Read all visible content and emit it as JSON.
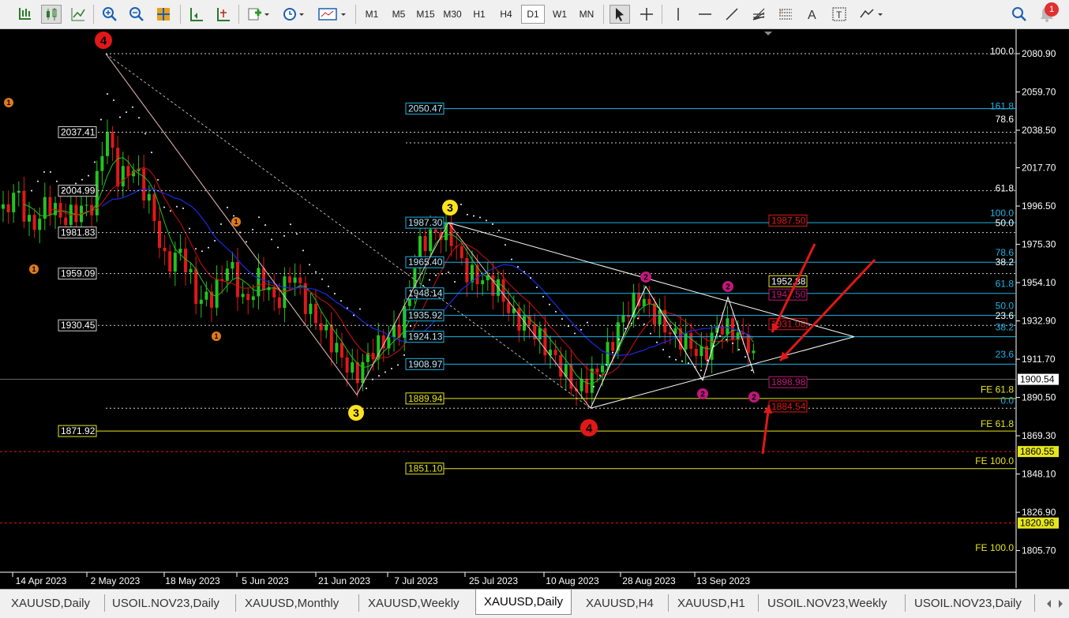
{
  "toolbar": {
    "timeframes": [
      "M1",
      "M5",
      "M15",
      "M30",
      "H1",
      "H4",
      "D1",
      "W1",
      "MN"
    ],
    "active_timeframe": "D1",
    "notification_count": "1",
    "icons": [
      "bar-chart-icon",
      "candlestick-icon",
      "line-chart-icon",
      "zoom-in-icon",
      "zoom-out-icon",
      "tile-windows-icon",
      "autoscroll-icon",
      "chart-shift-icon",
      "indicators-icon",
      "periods-icon",
      "templates-icon",
      "cursor-icon",
      "crosshair-icon",
      "vertical-line-icon",
      "horizontal-line-icon",
      "trendline-icon",
      "gann-icon",
      "fibonacci-icon",
      "text-icon",
      "text-label-icon",
      "shapes-icon",
      "search-icon",
      "notification-icon"
    ]
  },
  "price_axis": {
    "labels": [
      "2080.90",
      "2059.70",
      "2038.50",
      "2017.70",
      "1996.50",
      "1975.30",
      "1954.10",
      "1932.90",
      "1911.70",
      "1890.50",
      "1869.30",
      "1848.10",
      "1826.90",
      "1805.70"
    ],
    "current_price": "1900.54",
    "marker_1860": "1860.55",
    "marker_1820": "1820.96"
  },
  "time_axis": {
    "labels": [
      "14 Apr 2023",
      "2 May 2023",
      "18 May 2023",
      "5 Jun 2023",
      "21 Jun 2023",
      "7 Jul 2023",
      "25 Jul 2023",
      "10 Aug 2023",
      "28 Aug 2023",
      "13 Sep 2023"
    ]
  },
  "fib_left": {
    "levels": [
      "2037.41",
      "2004.99",
      "1981.83",
      "1959.09",
      "1930.45",
      "1871.92"
    ],
    "ratios": [
      "100.0",
      "78.6",
      "61.8",
      "50.0",
      "38.2",
      "FE 61.8",
      "FE 100.0"
    ]
  },
  "fib_right": {
    "levels": [
      "2050.47",
      "1987.30",
      "1965.40",
      "1948.14",
      "1935.92",
      "1924.13",
      "1908.97",
      "1889.94",
      "1851.10"
    ],
    "ratios": [
      "161.8",
      "100.0",
      "78.6",
      "61.8",
      "50.0",
      "38.2",
      "23.6",
      "0.0",
      "23.6",
      "FE 61.8",
      "FE 100.0",
      "FE 100.0"
    ]
  },
  "target_labels": [
    "1987.50",
    "1952.88",
    "1947.50",
    "1931.08",
    "1898.98",
    "1884.54"
  ],
  "wave_labels": [
    "4",
    "3",
    "3",
    "4",
    "1",
    "1",
    "1",
    "1",
    "2",
    "2",
    "2",
    "2"
  ],
  "chart_tabs": [
    "XAUUSD,Daily",
    "USOIL.NOV23,Daily",
    "XAUUSD,Monthly",
    "XAUUSD,Weekly",
    "XAUUSD,Daily",
    "XAUUSD,H4",
    "XAUUSD,H1",
    "USOIL.NOV23,Weekly",
    "USOIL.NOV23,Daily"
  ],
  "active_tab_index": 4,
  "colors": {
    "bull": "#22c41e",
    "bear": "#e01818",
    "ma_fast": "#22c41e",
    "ma_mid": "#d01010",
    "ma_slow": "#1a2be0",
    "fib_cyan": "#1eb4e6",
    "fib_yellow": "#e6e61e",
    "wave_red": "#e01818",
    "wave_yellow": "#ffe21e",
    "wave_magenta": "#c0187a",
    "wave_orange": "#e07a1e"
  }
}
